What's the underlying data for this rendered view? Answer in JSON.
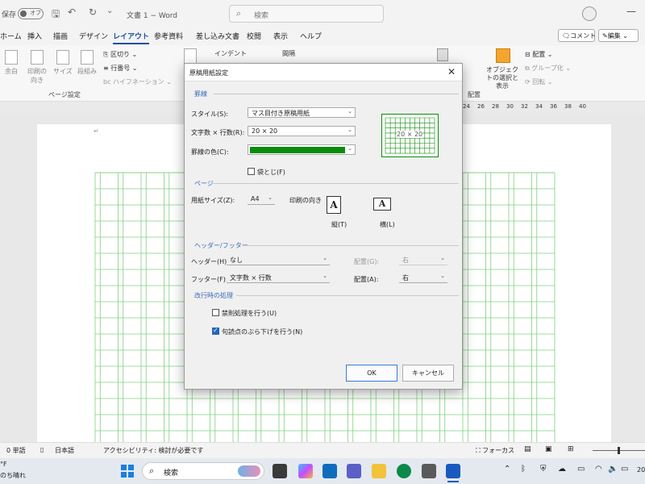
{
  "titlebar": {
    "autosave": "保存",
    "toggle": "オフ",
    "doc_title": "文書 1 − Word",
    "search_placeholder": "検索"
  },
  "tabs": [
    "ホーム",
    "挿入",
    "描画",
    "デザイン",
    "レイアウト",
    "参考資料",
    "差し込み文書",
    "校閲",
    "表示",
    "ヘルプ"
  ],
  "ribbon": {
    "comment": "コメント",
    "edit": "編集",
    "items": [
      "余白",
      "印刷の向き",
      "サイズ",
      "段組み",
      "区切り",
      "行番号",
      "ハイフネーション",
      "インデント",
      "間隔",
      "オブジェクトの選択と表示",
      "配置",
      "グループ化",
      "回転"
    ],
    "group_page": "ページ設定",
    "group_arrange": "配置"
  },
  "ruler": {
    "ticks": [
      "24",
      "26",
      "28",
      "30",
      "32",
      "34",
      "36",
      "38",
      "40"
    ]
  },
  "dialog": {
    "title": "原稿用紙設定",
    "sec_grid": "罫線",
    "style_label": "スタイル(S):",
    "style_value": "マス目付き原稿用紙",
    "count_label": "文字数 × 行数(R):",
    "count_value": "20 × 20",
    "color_label": "罫線の色(C):",
    "color_value": "#0a8c0a",
    "fold_label": "袋とじ(F)",
    "preview_text": "20 × 20",
    "sec_page": "ページ",
    "size_label": "用紙サイズ(Z):",
    "size_value": "A4",
    "orient_label": "印刷の向き",
    "portrait": "縦(T)",
    "landscape": "横(L)",
    "sec_hf": "ヘッダー/フッター",
    "header_label": "ヘッダー(H):",
    "header_value": "なし",
    "align_label1": "配置(G):",
    "align_value1": "右",
    "footer_label": "フッター(F):",
    "footer_value": "文字数 × 行数",
    "align_label2": "配置(A):",
    "align_value2": "右",
    "sec_break": "改行時の処理",
    "kinsoku_label": "禁則処理を行う(U)",
    "kutoten_label": "句読点のぶら下げを行う(N)",
    "ok": "OK",
    "cancel": "キャンセル"
  },
  "status": {
    "words": "0 単語",
    "lang": "日本語",
    "access": "アクセシビリティ: 検討が必要です",
    "focus": "フォーカス"
  },
  "taskbar": {
    "search": "検索",
    "weather1": "°F",
    "weather2": "のち晴れ",
    "clock": "20"
  }
}
